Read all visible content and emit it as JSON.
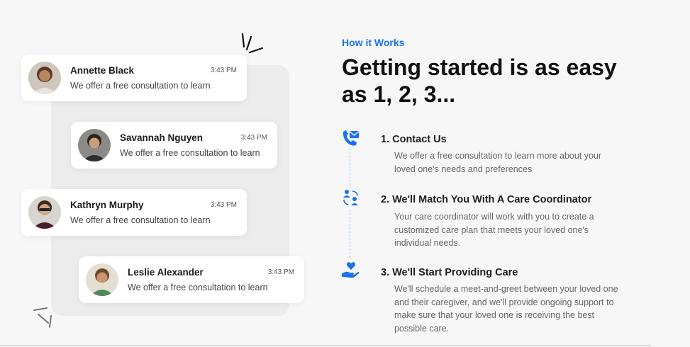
{
  "chat": {
    "messages": [
      {
        "name": "Annette Black",
        "time": "3:43 PM",
        "text": "We offer a free consultation to learn"
      },
      {
        "name": "Savannah Nguyen",
        "time": "3:43 PM",
        "text": "We offer a free consultation to learn"
      },
      {
        "name": "Kathryn Murphy",
        "time": "3:43 PM",
        "text": "We offer a free consultation to learn"
      },
      {
        "name": "Leslie Alexander",
        "time": "3:43 PM",
        "text": "We offer a free consultation to learn"
      }
    ]
  },
  "section": {
    "eyebrow": "How it Works",
    "headline": "Getting started is as easy as 1, 2, 3...",
    "accent_color": "#1a73e8"
  },
  "steps": [
    {
      "icon": "phone-mail-icon",
      "title": "1. Contact Us",
      "text": "We offer a free consultation to learn more about your loved one's needs and preferences"
    },
    {
      "icon": "people-match-icon",
      "title": "2. We'll Match You With A Care Coordinator",
      "text": "Your care coordinator will work with you to create a customized care plan that meets your loved one's individual needs."
    },
    {
      "icon": "hand-heart-icon",
      "title": "3. We'll Start Providing Care",
      "text": "We'll schedule a meet-and-greet between your loved one and their caregiver, and we'll provide ongoing support to make sure that your loved one is receiving the best possible care."
    }
  ]
}
